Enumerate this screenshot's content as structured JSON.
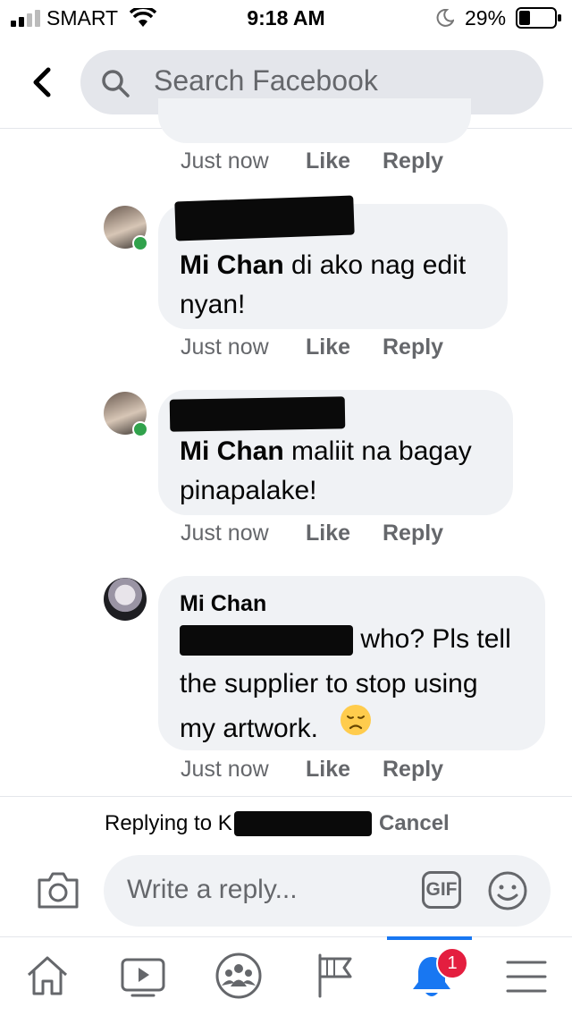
{
  "status_bar": {
    "carrier": "SMART",
    "time": "9:18 AM",
    "battery": "29%"
  },
  "header": {
    "search_placeholder": "Search Facebook"
  },
  "first_meta": {
    "time": "Just now",
    "like": "Like",
    "reply": "Reply"
  },
  "comments": [
    {
      "mention": "Mi Chan",
      "line1_rest": " di ako nag edit",
      "line2": "nyan!",
      "time": "Just now",
      "like": "Like",
      "reply": "Reply"
    },
    {
      "mention": "Mi Chan",
      "line1_rest": " maliit na bagay",
      "line2": "pinapalake!",
      "time": "Just now",
      "like": "Like",
      "reply": "Reply"
    },
    {
      "author": "Mi Chan",
      "line1_rest": " who? Pls tell",
      "line2": "the supplier to stop using",
      "line3": "my artwork.",
      "emoji": "disappointed-face",
      "time": "Just now",
      "like": "Like",
      "reply": "Reply"
    }
  ],
  "reply_bar": {
    "replying_to": "Replying to K",
    "cancel": "Cancel",
    "placeholder": "Write a reply...",
    "gif": "GIF"
  },
  "bottom_nav": {
    "items": [
      "home-icon",
      "watch-icon",
      "groups-icon",
      "pages-icon",
      "notifications-icon",
      "menu-icon"
    ],
    "notification_count": "1",
    "active_color": "#1877f2"
  }
}
